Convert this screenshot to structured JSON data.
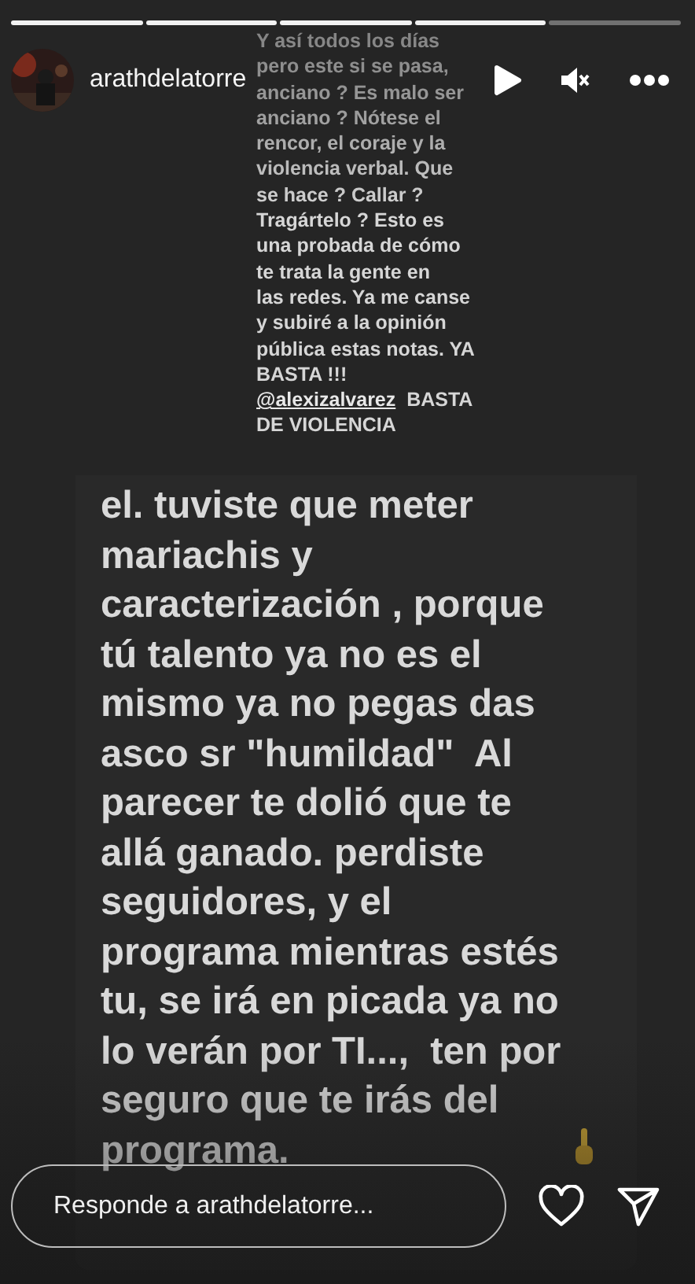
{
  "progress": [
    {
      "level": 1
    },
    {
      "level": 1
    },
    {
      "level": 1
    },
    {
      "level": 1
    },
    {
      "level": 0
    }
  ],
  "header": {
    "username": "arathdelatorre"
  },
  "caption": {
    "text_before": "Y así todos los días\npero este si se pasa,\nanciano ? Es malo ser\nanciano ? Nótese el\nrencor, el coraje y la\nviolencia verbal. Que\nse hace ? Callar ?\nTragártelo ? Esto es\nuna probada de cómo\nte trata la gente en\nlas redes. Ya me canse\ny subiré a la opinión\npública estas notas. YA\nBASTA !!!\n",
    "mention": "@alexizalvarez",
    "text_after": "  BASTA\nDE VIOLENCIA"
  },
  "message": {
    "text": "el. tuviste que meter\nmariachis y\ncaracterización , porque\ntú talento ya no es el\nmismo ya no pegas das\nasco sr \"humildad\"  Al\nparecer te dolió que te\nallá ganado. perdiste\nseguidores, y el\nprograma mientras estés\ntu, se irá en picada ya no\nlo verán por TI...,  ten por\nseguro que te irás del\nprograma."
  },
  "reply": {
    "placeholder": "Responde a arathdelatorre..."
  }
}
